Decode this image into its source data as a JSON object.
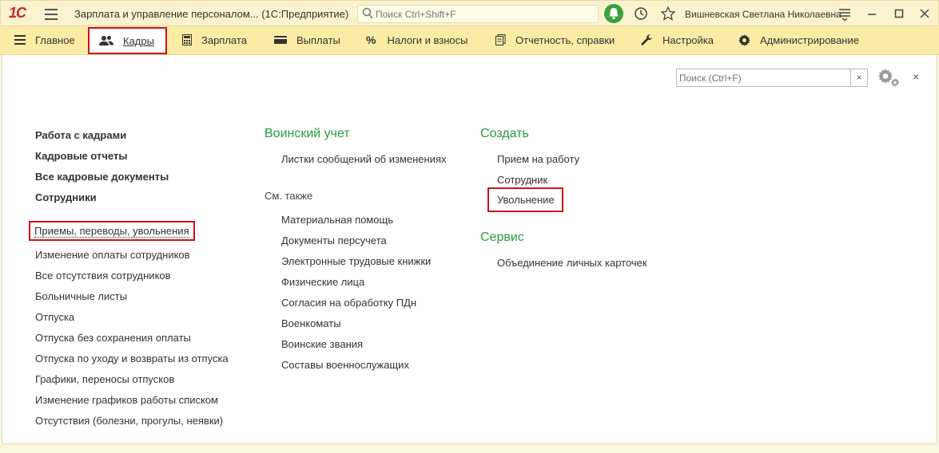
{
  "titlebar": {
    "logo": "1С",
    "app_title": "Зарплата и управление персоналом...  (1С:Предприятие)",
    "search_placeholder": "Поиск Ctrl+Shift+F",
    "user_name": "Вишневская Светлана Николаевна"
  },
  "menu": {
    "items": [
      {
        "label": "Главное",
        "icon": "hamburger-icon"
      },
      {
        "label": "Кадры",
        "icon": "people-icon",
        "active": true
      },
      {
        "label": "Зарплата",
        "icon": "calculator-icon"
      },
      {
        "label": "Выплаты",
        "icon": "wallet-icon"
      },
      {
        "label": "Налоги и взносы",
        "icon": "percent-icon"
      },
      {
        "label": "Отчетность, справки",
        "icon": "documents-icon"
      },
      {
        "label": "Настройка",
        "icon": "wrench-icon"
      },
      {
        "label": "Администрирование",
        "icon": "gear-icon"
      }
    ]
  },
  "panel": {
    "search_placeholder": "Поиск (Ctrl+F)",
    "clear": "×",
    "close": "×"
  },
  "col1": {
    "bold_links": [
      "Работа с кадрами",
      "Кадровые отчеты",
      "Все кадровые документы",
      "Сотрудники"
    ],
    "links": [
      "Приемы, переводы, увольнения",
      "Изменение оплаты сотрудников",
      "Все отсутствия сотрудников",
      "Больничные листы",
      "Отпуска",
      "Отпуска без сохранения оплаты",
      "Отпуска по уходу и возвраты из отпуска",
      "Графики, переносы отпусков",
      "Изменение графиков работы списком",
      "Отсутствия (болезни, прогулы, неявки)"
    ]
  },
  "col2": {
    "heading": "Воинский учет",
    "links_top": [
      "Листки сообщений об изменениях"
    ],
    "see_also": "См. также",
    "links": [
      "Материальная помощь",
      "Документы перс­учета",
      "Электронные трудовые книжки",
      "Физические лица",
      "Согласия на обработку ПДн",
      "Военкоматы",
      "Воинские звания",
      "Составы военнослужащих"
    ]
  },
  "col3": {
    "heading_create": "Создать",
    "create_links": [
      "Прием на работу",
      "Сотрудник",
      "Увольнение"
    ],
    "heading_service": "Сервис",
    "service_links": [
      "Объединение личных карточек"
    ]
  }
}
